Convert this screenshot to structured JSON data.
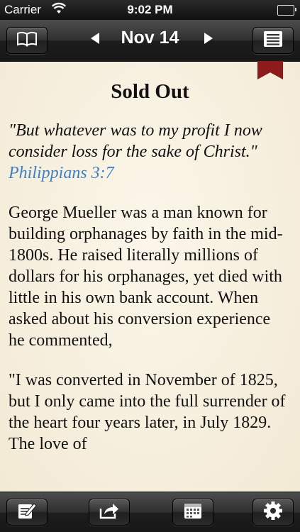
{
  "status_bar": {
    "carrier": "Carrier",
    "time": "9:02 PM"
  },
  "nav": {
    "title": "Nov 14",
    "icons": {
      "left": "book-icon",
      "prev": "arrow-left-icon",
      "next": "arrow-right-icon",
      "right": "list-icon"
    }
  },
  "article": {
    "title": "Sold Out",
    "verse_text": "\"But whatever was to my profit I now consider loss for the sake of Christ.\"",
    "verse_ref": "Philippians 3:7",
    "paragraphs": [
      "George Mueller was a man known for building orphanages by faith in the mid-1800s. He raised literally millions of dollars for his orphanages, yet died with little in his own bank account. When asked about his conversion experience he commented,",
      "\"I was converted in November of 1825, but I only came into the full surrender of the heart four years later, in July 1829. The love of"
    ]
  },
  "toolbar": {
    "icons": [
      "edit-note-icon",
      "share-icon",
      "calendar-icon",
      "gear-icon"
    ]
  },
  "colors": {
    "link": "#3e7fc6",
    "ribbon": "#8e1b1b",
    "page": "#f6efde"
  }
}
